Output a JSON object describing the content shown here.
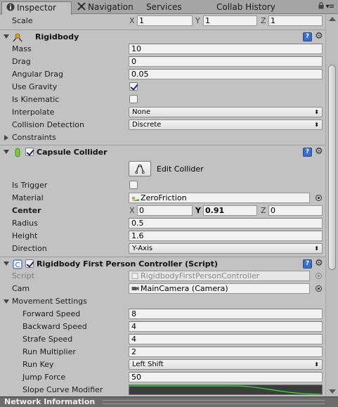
{
  "tabs": [
    {
      "label": "Inspector",
      "icon": "info-icon",
      "active": true
    },
    {
      "label": "Navigation",
      "icon": "navigation-icon",
      "active": false
    },
    {
      "label": "Services",
      "active": false
    },
    {
      "label": "Collab History",
      "active": false
    }
  ],
  "transform_scale": {
    "label": "Scale",
    "x": "1",
    "y": "1",
    "z": "1",
    "axis_x": "X",
    "axis_y": "Y",
    "axis_z": "Z"
  },
  "rigidbody": {
    "title": "Rigidbody",
    "mass_label": "Mass",
    "mass": "10",
    "drag_label": "Drag",
    "drag": "0",
    "angular_drag_label": "Angular Drag",
    "angular_drag": "0.05",
    "use_gravity_label": "Use Gravity",
    "use_gravity": true,
    "is_kinematic_label": "Is Kinematic",
    "is_kinematic": false,
    "interpolate_label": "Interpolate",
    "interpolate": "None",
    "collision_detection_label": "Collision Detection",
    "collision_detection": "Discrete",
    "constraints_label": "Constraints"
  },
  "capsule_collider": {
    "title": "Capsule Collider",
    "edit_collider_label": "Edit Collider",
    "is_trigger_label": "Is Trigger",
    "is_trigger": false,
    "material_label": "Material",
    "material": "ZeroFriction",
    "center_label": "Center",
    "center_x": "0",
    "center_y": "0.91",
    "center_z": "0",
    "radius_label": "Radius",
    "radius": "0.5",
    "height_label": "Height",
    "height": "1.6",
    "direction_label": "Direction",
    "direction": "Y-Axis"
  },
  "fps_controller": {
    "title": "Rigidbody First Person Controller (Script)",
    "script_label": "Script",
    "script": "RigidbodyFirstPersonController",
    "cam_label": "Cam",
    "cam": "MainCamera (Camera)",
    "movement_settings_label": "Movement Settings",
    "forward_speed_label": "Forward Speed",
    "forward_speed": "8",
    "backward_speed_label": "Backward Speed",
    "backward_speed": "4",
    "strafe_speed_label": "Strafe Speed",
    "strafe_speed": "4",
    "run_multiplier_label": "Run Multiplier",
    "run_multiplier": "2",
    "run_key_label": "Run Key",
    "run_key": "Left Shift",
    "jump_force_label": "Jump Force",
    "jump_force": "50",
    "slope_curve_label": "Slope Curve Modifier"
  },
  "help_glyph": "?",
  "gear_glyph": "⚙",
  "dropdown_arrow": "⬍",
  "bottom_panel": {
    "title": "Network Information"
  },
  "colors": {
    "accent": "#3a6fc4",
    "curve": "#2ee82e",
    "panel_bg": "#c2c2c2"
  }
}
